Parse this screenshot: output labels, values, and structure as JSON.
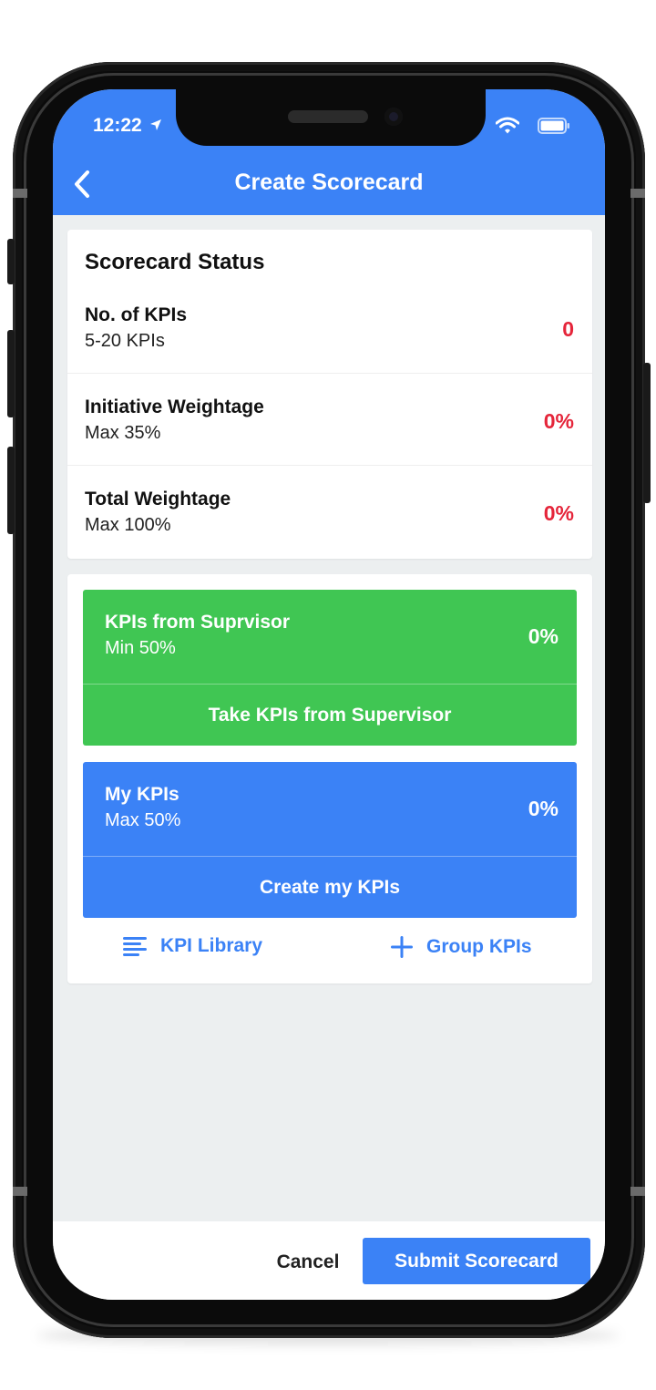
{
  "status_bar": {
    "time": "12:22",
    "icons": [
      "location-arrow-icon",
      "wifi-icon",
      "battery-icon"
    ]
  },
  "header": {
    "title": "Create Scorecard",
    "back_icon": "chevron-left-icon"
  },
  "scorecard_status": {
    "title": "Scorecard Status",
    "rows": [
      {
        "label": "No. of KPIs",
        "sub": "5-20 KPIs",
        "value": "0"
      },
      {
        "label": "Initiative Weightage",
        "sub": "Max 35%",
        "value": "0%"
      },
      {
        "label": "Total Weightage",
        "sub": "Max 100%",
        "value": "0%"
      }
    ]
  },
  "kpi_sources": {
    "supervisor": {
      "title": "KPIs from Suprvisor",
      "sub": "Min 50%",
      "percent": "0%",
      "action": "Take KPIs from Supervisor"
    },
    "mine": {
      "title": "My KPIs",
      "sub": "Max 50%",
      "percent": "0%",
      "action": "Create my KPIs"
    },
    "links": {
      "library": "KPI Library",
      "library_icon": "list-icon",
      "group": "Group KPIs",
      "group_icon": "plus-icon"
    }
  },
  "footer": {
    "cancel": "Cancel",
    "submit": "Submit Scorecard"
  },
  "colors": {
    "primary": "#3b82f6",
    "success": "#40c653",
    "danger": "#e5253a",
    "background": "#eceff0"
  }
}
